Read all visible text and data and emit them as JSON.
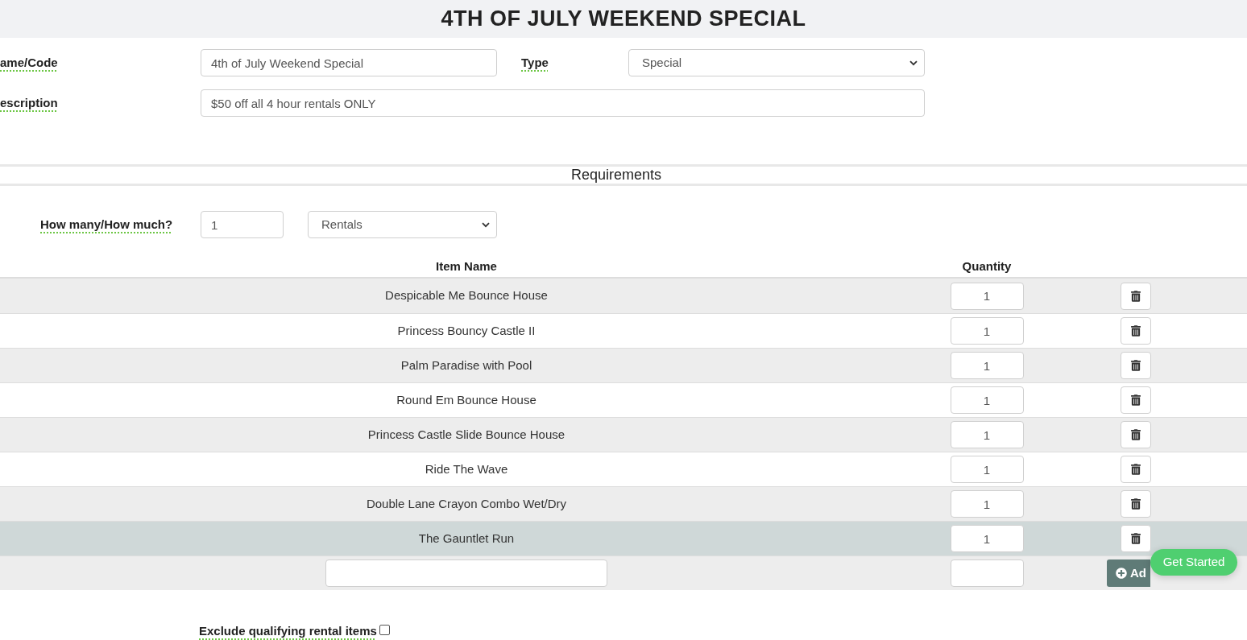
{
  "header": {
    "title": "4TH OF JULY WEEKEND SPECIAL"
  },
  "form": {
    "name_code": {
      "label": "ame/Code",
      "value": "4th of July Weekend Special"
    },
    "type": {
      "label": "Type",
      "value": "Special"
    },
    "description": {
      "label": "escription",
      "value": "$50 off all 4 hour rentals ONLY"
    }
  },
  "requirements": {
    "title": "Requirements",
    "how_many": {
      "label": "How many/How much?",
      "value": "1"
    },
    "unit": {
      "value": "Rentals"
    }
  },
  "table": {
    "columns": [
      "Item Name",
      "Quantity"
    ],
    "rows": [
      {
        "name": "Despicable Me Bounce House",
        "quantity": "1",
        "selected": false
      },
      {
        "name": "Princess Bouncy Castle II",
        "quantity": "1",
        "selected": false
      },
      {
        "name": "Palm Paradise with Pool",
        "quantity": "1",
        "selected": false
      },
      {
        "name": "Round Em Bounce House",
        "quantity": "1",
        "selected": false
      },
      {
        "name": "Princess Castle Slide Bounce House",
        "quantity": "1",
        "selected": false
      },
      {
        "name": "Ride The Wave",
        "quantity": "1",
        "selected": false
      },
      {
        "name": "Double Lane Crayon Combo Wet/Dry",
        "quantity": "1",
        "selected": false
      },
      {
        "name": "The Gauntlet Run",
        "quantity": "1",
        "selected": true
      }
    ],
    "add_row": {
      "button": "Ad"
    }
  },
  "exclude": {
    "label": "Exclude qualifying rental items",
    "checked": false
  },
  "chat_button": {
    "label": "Get Started"
  }
}
